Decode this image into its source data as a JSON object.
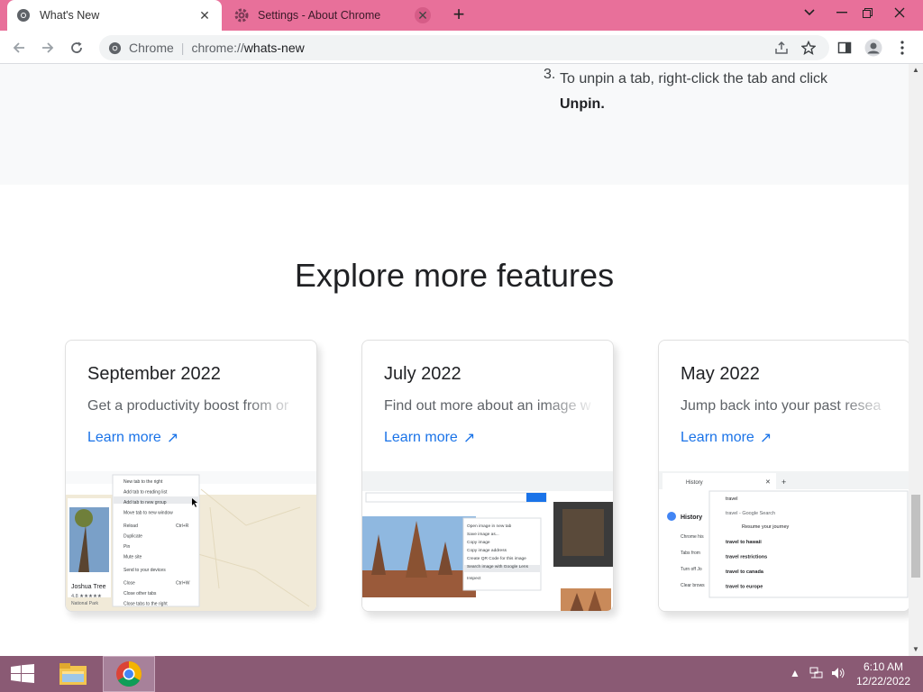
{
  "tabs": [
    {
      "title": "What's New",
      "active": true
    },
    {
      "title": "Settings - About Chrome",
      "active": false
    }
  ],
  "omnibox": {
    "scheme_label": "Chrome",
    "url_prefix": "chrome://",
    "url_path": "whats-new"
  },
  "content": {
    "step_number": "3.",
    "step_text": "To unpin a tab, right-click the tab and click",
    "step_bold": "Unpin.",
    "section_title": "Explore more features",
    "cards": [
      {
        "date": "September 2022",
        "desc": "Get a productivity boost from or",
        "learn": "Learn more"
      },
      {
        "date": "July 2022",
        "desc": "Find out more about an image w",
        "learn": "Learn more"
      },
      {
        "date": "May 2022",
        "desc": "Jump back into your past resea",
        "learn": "Learn more"
      }
    ],
    "card1_shot": {
      "menu_items": [
        "New tab to the right",
        "Add tab to reading list",
        "Add tab to new group",
        "Move tab to new window",
        "Reload",
        "Duplicate",
        "Pin",
        "Mute site",
        "Send to your devices",
        "Close",
        "Close other tabs",
        "Close tabs to the right"
      ],
      "place_name": "Joshua Tree",
      "place_rating": "4.8 ★★★★★",
      "place_type": "National Park",
      "shortcut_reload": "Ctrl+R",
      "shortcut_close": "Ctrl+W"
    },
    "card2_shot": {
      "menu_items": [
        "Open image in new tab",
        "Save image as...",
        "Copy image",
        "Copy image address",
        "Create QR Code for this image",
        "Search image with Google Lens",
        "Inspect"
      ]
    },
    "card3_shot": {
      "tab_label": "History",
      "sidebar_title": "History",
      "sidebar_items": [
        "Chrome his",
        "Tabs from",
        "Turn off Jo",
        "Clear brows"
      ],
      "search_query": "travel",
      "suggestion_google": "travel - Google Search",
      "suggestion_journey": "Resume your journey",
      "suggestions": [
        "travel to hawaii",
        "travel restrictions",
        "travel to canada",
        "travel to europe"
      ]
    }
  },
  "taskbar": {
    "time": "6:10 AM",
    "date": "12/22/2022"
  },
  "colors": {
    "tabstrip": "#e8709a",
    "accent_link": "#1a73e8",
    "taskbar": "#8a5a74"
  }
}
